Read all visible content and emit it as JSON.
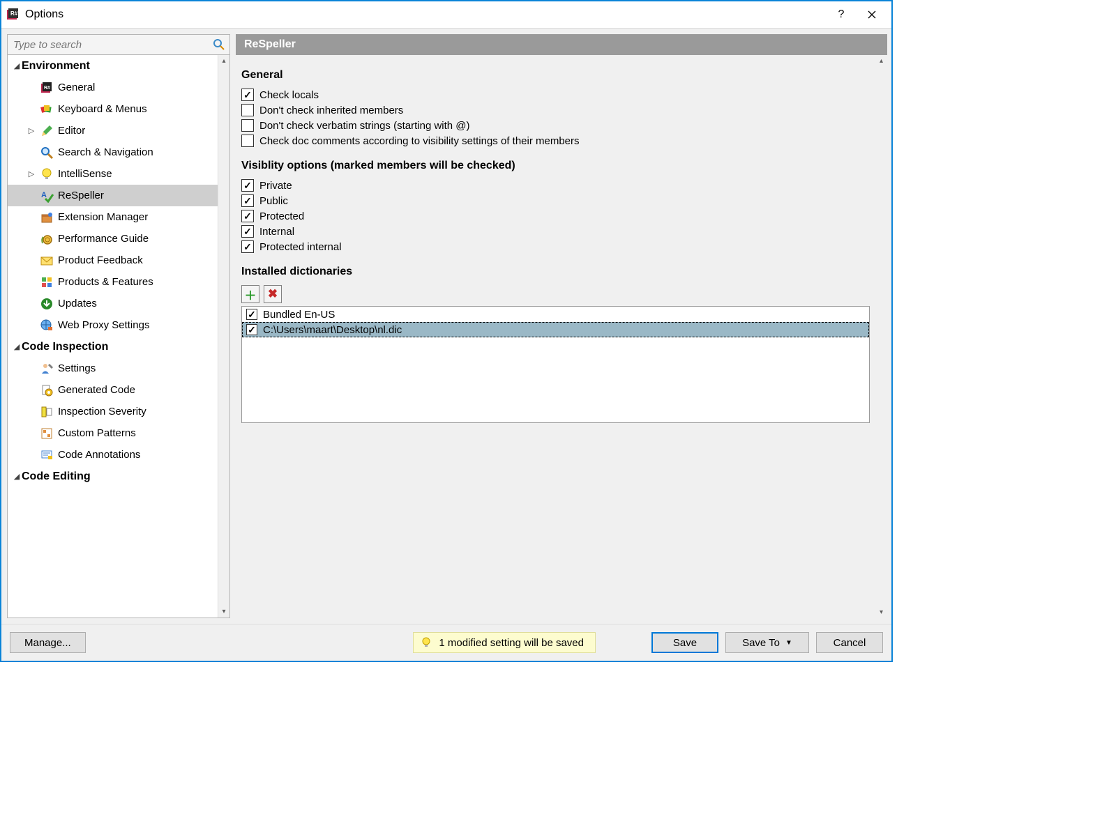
{
  "window": {
    "title": "Options"
  },
  "search": {
    "placeholder": "Type to search"
  },
  "tree": {
    "groups": [
      {
        "name": "environment",
        "label": "Environment",
        "expanded": true,
        "items": [
          {
            "id": "general",
            "label": "General",
            "icon": "resharper"
          },
          {
            "id": "keyboard",
            "label": "Keyboard & Menus",
            "icon": "swatch"
          },
          {
            "id": "editor",
            "label": "Editor",
            "icon": "pencil",
            "expandable": true
          },
          {
            "id": "search-nav",
            "label": "Search & Navigation",
            "icon": "magnifier"
          },
          {
            "id": "intellisense",
            "label": "IntelliSense",
            "icon": "bulb",
            "expandable": true
          },
          {
            "id": "respeller",
            "label": "ReSpeller",
            "icon": "spellcheck",
            "selected": true
          },
          {
            "id": "ext-mgr",
            "label": "Extension Manager",
            "icon": "package"
          },
          {
            "id": "perf-guide",
            "label": "Performance Guide",
            "icon": "snail"
          },
          {
            "id": "feedback",
            "label": "Product Feedback",
            "icon": "envelope"
          },
          {
            "id": "products",
            "label": "Products & Features",
            "icon": "grid"
          },
          {
            "id": "updates",
            "label": "Updates",
            "icon": "download-circle"
          },
          {
            "id": "proxy",
            "label": "Web Proxy Settings",
            "icon": "globe-plug"
          }
        ]
      },
      {
        "name": "code-inspection",
        "label": "Code Inspection",
        "expanded": true,
        "items": [
          {
            "id": "ci-settings",
            "label": "Settings",
            "icon": "person-wrench"
          },
          {
            "id": "gen-code",
            "label": "Generated Code",
            "icon": "gear-doc"
          },
          {
            "id": "severity",
            "label": "Inspection Severity",
            "icon": "ruler"
          },
          {
            "id": "patterns",
            "label": "Custom Patterns",
            "icon": "pattern"
          },
          {
            "id": "annotations",
            "label": "Code Annotations",
            "icon": "annotation"
          }
        ]
      },
      {
        "name": "code-editing",
        "label": "Code Editing",
        "expanded": true
      }
    ]
  },
  "page": {
    "title": "ReSpeller",
    "sections": {
      "general": {
        "title": "General",
        "options": [
          {
            "id": "check-locals",
            "label": "Check locals",
            "checked": true
          },
          {
            "id": "no-inherited",
            "label": "Don't check inherited members",
            "checked": false
          },
          {
            "id": "no-verbatim",
            "label": "Don't check verbatim strings (starting with @)",
            "checked": false
          },
          {
            "id": "doc-comments",
            "label": "Check doc comments according to visibility settings of their members",
            "checked": false
          }
        ]
      },
      "visibility": {
        "title": "Visiblity options (marked members will be checked)",
        "options": [
          {
            "id": "private",
            "label": "Private",
            "checked": true
          },
          {
            "id": "public",
            "label": "Public",
            "checked": true
          },
          {
            "id": "protected",
            "label": "Protected",
            "checked": true
          },
          {
            "id": "internal",
            "label": "Internal",
            "checked": true
          },
          {
            "id": "prot-int",
            "label": "Protected internal",
            "checked": true
          }
        ]
      },
      "dictionaries": {
        "title": "Installed dictionaries",
        "items": [
          {
            "label": "Bundled En-US",
            "checked": true,
            "selected": false
          },
          {
            "label": "C:\\Users\\maart\\Desktop\\nl.dic",
            "checked": true,
            "selected": true
          }
        ]
      }
    }
  },
  "status": {
    "text": "1  modified setting will be saved"
  },
  "buttons": {
    "manage": "Manage...",
    "save": "Save",
    "saveto": "Save To",
    "cancel": "Cancel"
  }
}
